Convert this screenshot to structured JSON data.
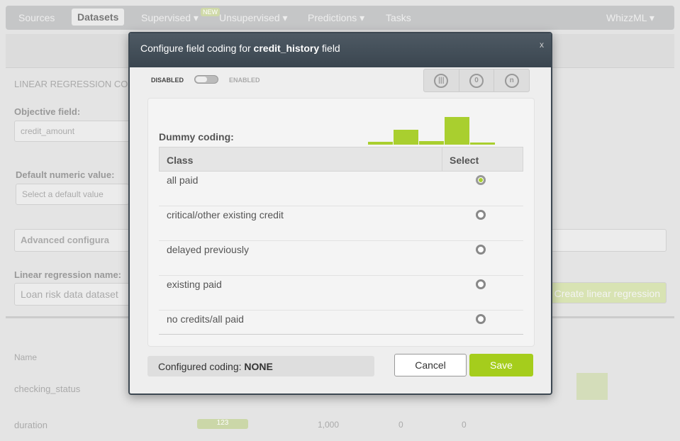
{
  "nav": {
    "items": [
      "Sources",
      "Datasets",
      "Supervised ▾",
      "Unsupervised ▾",
      "Predictions ▾",
      "Tasks"
    ],
    "badge": "NEW",
    "user": "WhizzML ▾"
  },
  "background": {
    "section": "LINEAR REGRESSION CON",
    "objective_label": "Objective field:",
    "objective_value": "credit_amount",
    "default_label": "Default numeric value:",
    "default_placeholder": "Select a default value",
    "advanced": "Advanced configura",
    "name_label": "Linear regression name:",
    "name_value": "Loan risk data dataset",
    "create_button": "Create linear regression",
    "col_name": "Name",
    "rows": [
      {
        "name": "checking_status"
      },
      {
        "name": "duration",
        "type": "123",
        "count": "1,000",
        "missing": "0",
        "errors": "0"
      }
    ]
  },
  "modal": {
    "title_prefix": "Configure field coding for ",
    "field": "credit_history",
    "title_suffix": " field",
    "close": "x",
    "disabled": "DISABLED",
    "enabled": "ENABLED",
    "enabled_state": false,
    "coding_icons": [
      "dummy-coding-icon",
      "contrast-coding-icon",
      "other-coding-icon"
    ],
    "dummy_title": "Dummy coding:",
    "histogram": [
      4,
      21,
      5,
      39,
      3
    ],
    "columns": [
      "Class",
      "Select"
    ],
    "classes": [
      {
        "label": "all paid",
        "selected": true
      },
      {
        "label": "critical/other existing credit",
        "selected": false
      },
      {
        "label": "delayed previously",
        "selected": false
      },
      {
        "label": "existing paid",
        "selected": false
      },
      {
        "label": "no credits/all paid",
        "selected": false
      }
    ],
    "configured_label": "Configured coding: ",
    "configured_value": "NONE",
    "cancel": "Cancel",
    "save": "Save"
  },
  "colors": {
    "accent": "#a5cd1c",
    "header": "#3d4852"
  }
}
